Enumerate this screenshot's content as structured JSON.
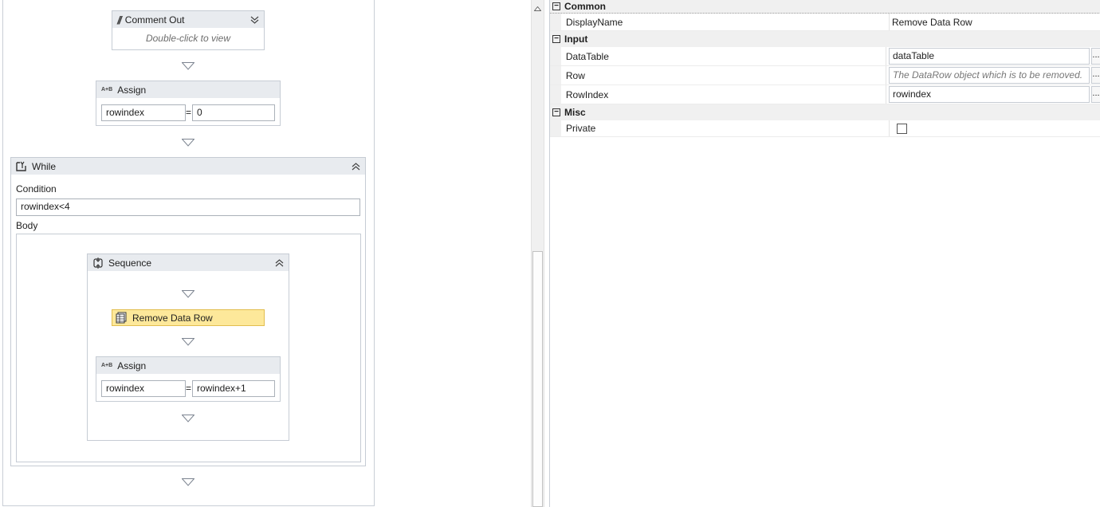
{
  "designer": {
    "comment_out": {
      "title": "Comment Out",
      "hint": "Double-click to view"
    },
    "assign1": {
      "title": "Assign",
      "to": "rowindex",
      "eq": "=",
      "value": "0"
    },
    "while": {
      "title": "While",
      "condition_label": "Condition",
      "condition_value": "rowindex<4",
      "body_label": "Body",
      "sequence": {
        "title": "Sequence",
        "remove_row": {
          "title": "Remove Data Row"
        },
        "assign2": {
          "title": "Assign",
          "to": "rowindex",
          "eq": "=",
          "value": "rowindex+1"
        }
      }
    }
  },
  "properties": {
    "categories": {
      "common": "Common",
      "input": "Input",
      "misc": "Misc"
    },
    "expander_symbol": "−",
    "ellipsis": "...",
    "display_name": {
      "label": "DisplayName",
      "value": "Remove Data Row"
    },
    "data_table": {
      "label": "DataTable",
      "value": "dataTable"
    },
    "row": {
      "label": "Row",
      "placeholder": "The DataRow object which is to be removed."
    },
    "row_index": {
      "label": "RowIndex",
      "value": "rowindex"
    },
    "private": {
      "label": "Private",
      "checked": false
    }
  },
  "colors": {
    "activity_header": "#e8ebef",
    "selected_activity": "#fde89a",
    "selected_border": "#e2be4f",
    "category_bg": "#f0f0f0"
  },
  "icons": {
    "comment_out": "comment-slashes-icon",
    "assign": "assign-ab-icon",
    "while": "while-loop-icon",
    "sequence": "sequence-icon",
    "remove_row": "data-table-icon",
    "collapse": "collapse-chevron-icon",
    "expand": "expand-chevron-icon",
    "drop_arrow": "drop-arrow-icon"
  }
}
